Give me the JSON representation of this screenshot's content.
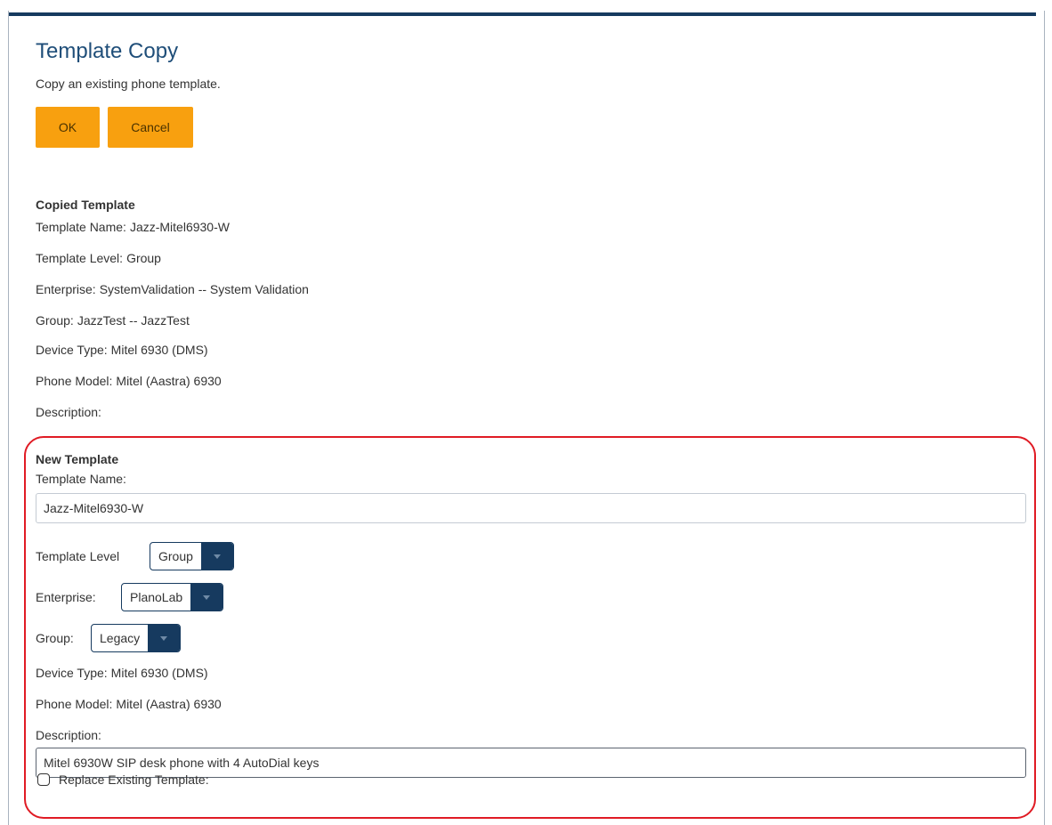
{
  "header": {
    "title": "Template Copy",
    "subtitle": "Copy an existing phone template."
  },
  "actions": {
    "ok_label": "OK",
    "cancel_label": "Cancel"
  },
  "colors": {
    "accent_button": "#f8a00f",
    "title_blue": "#1f4e79",
    "dropdown_navy": "#163a5f",
    "highlight_red": "#e01b24"
  },
  "copied": {
    "section_title": "Copied Template",
    "template_name_label": "Template Name:",
    "template_name": "Jazz-Mitel6930-W",
    "template_level_label": "Template Level:",
    "template_level": "Group",
    "enterprise_label": "Enterprise:",
    "enterprise": "SystemValidation -- System Validation",
    "group_label": "Group:",
    "group": "JazzTest -- JazzTest",
    "device_type_label": "Device Type:",
    "device_type": "Mitel 6930 (DMS)",
    "phone_model_label": "Phone Model:",
    "phone_model": "Mitel (Aastra) 6930",
    "description_label": "Description:",
    "description": ""
  },
  "new_template": {
    "section_title": "New Template",
    "template_name_label": "Template Name:",
    "template_name_value": "Jazz-Mitel6930-W",
    "template_level_label": "Template Level",
    "template_level_selected": "Group",
    "enterprise_label": "Enterprise:",
    "enterprise_selected": "PlanoLab",
    "group_label": "Group:",
    "group_selected": "Legacy",
    "device_type_label": "Device Type:",
    "device_type": "Mitel 6930 (DMS)",
    "phone_model_label": "Phone Model:",
    "phone_model": "Mitel (Aastra) 6930",
    "description_label": "Description:",
    "description_value": "Mitel 6930W SIP desk phone with 4 AutoDial keys",
    "replace_label": "Replace Existing Template:",
    "replace_checked": false,
    "dropdown_icon": "chevron-down-icon"
  }
}
